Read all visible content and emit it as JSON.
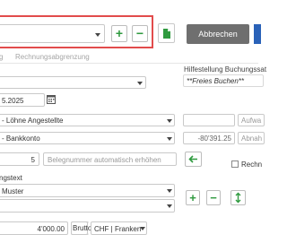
{
  "toolbar": {
    "add_label": "+",
    "remove_label": "−",
    "cancel_label": "Abbrechen"
  },
  "tabs": [
    {
      "label": "g"
    },
    {
      "label": "Rechnungsabgrenzung"
    }
  ],
  "help": {
    "title": "Hilfestellung Buchungssat",
    "value": "**Freies Buchen**"
  },
  "form": {
    "date": "5.2025",
    "account_debit": "- Löhne Angestellte",
    "debit_type_placeholder": "Aufwa",
    "account_credit": "- Bankkonto",
    "credit_amount": "-80'391.25",
    "credit_type_placeholder": "Abnah",
    "doc_number": "5",
    "doc_number_placeholder": "Belegnummer automatisch erhöhen",
    "checkbox_label": "Rechn",
    "booking_text_label": "ngstext",
    "booking_text_value": "Muster",
    "amount": "4'000.00",
    "gross_label": "Brutto",
    "currency": "CHF | Franken"
  },
  "colors": {
    "accent_green": "#2f9a3f",
    "highlight_red": "#e24c4c",
    "cancel_button": "#6f6f6f",
    "primary_blue": "#2a62b8"
  }
}
